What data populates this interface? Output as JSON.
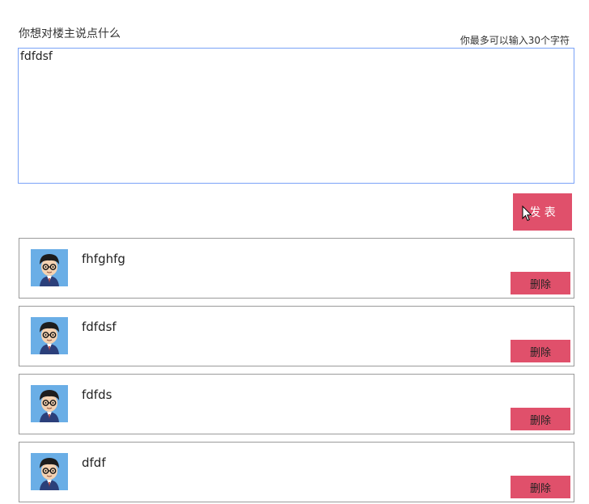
{
  "composer": {
    "prompt_label": "你想对楼主说点什么",
    "char_hint": "你最多可以输入30个字符",
    "input_value": "fdfdsf",
    "publish_label": "发 表"
  },
  "comments": [
    {
      "text": "fhfghfg",
      "delete_label": "删除"
    },
    {
      "text": "fdfdsf",
      "delete_label": "删除"
    },
    {
      "text": "fdfds",
      "delete_label": "删除"
    },
    {
      "text": "dfdf",
      "delete_label": "删除"
    }
  ],
  "colors": {
    "accent": "#e0506b",
    "input_border": "#7aa2f7",
    "avatar_bg": "#6aaee6"
  },
  "icons": {
    "avatar": "cartoon-boy-avatar",
    "cursor": "mouse-pointer-icon"
  }
}
